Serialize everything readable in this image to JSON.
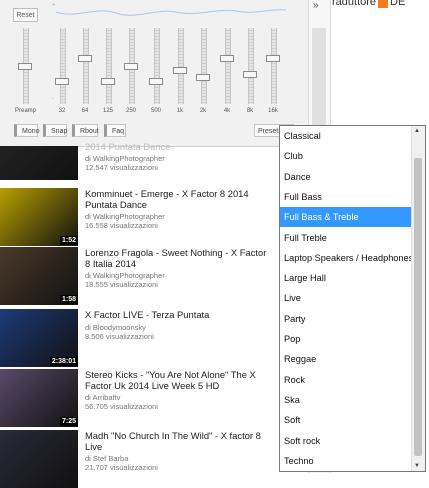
{
  "equalizer": {
    "reset_label": "Reset",
    "db_top": "+",
    "db_bottom": "-",
    "bands": [
      "Preamp",
      "32",
      "64",
      "125",
      "250",
      "500",
      "1k",
      "2k",
      "4k",
      "8k",
      "16k"
    ],
    "levels": [
      0.0,
      -0.4,
      0.2,
      -0.4,
      0.0,
      -0.4,
      -0.1,
      -0.3,
      0.2,
      -0.2,
      0.2
    ],
    "buttons": [
      "Mono",
      "Snap",
      "Rbout",
      "Faq"
    ],
    "presets_label": "Presets",
    "presets_arrow": "▼"
  },
  "sidebar": {
    "collapse_icon": "»"
  },
  "topright": {
    "text": "raduttore",
    "icon": "blogger-icon",
    "trail": "DE"
  },
  "videos": [
    {
      "title": "2014 Puntata Dance",
      "author": "di WalkingPhotographer",
      "views": "12.547 visualizzazioni",
      "duration": "",
      "thumb_color": "#222"
    },
    {
      "title": "Komminuet - Emerge - X Factor 8 2014 Puntata Dance",
      "author": "di WalkingPhotographer",
      "views": "16.558 visualizzazioni",
      "duration": "1:52",
      "thumb_color": "#b8a000"
    },
    {
      "title": "Lorenzo Fragola - Sweet Nothing - X Factor 8 Italia 2014",
      "author": "di WalkingPhotographer",
      "views": "18.555 visualizzazioni",
      "duration": "1:58",
      "thumb_color": "#4a3a2a"
    },
    {
      "title": "X Factor LIVE - Terza Puntata",
      "author": "di Bloodymoonsky",
      "views": "8.506 visualizzazioni",
      "duration": "2:38:01",
      "thumb_color": "#1d3a7a"
    },
    {
      "title": "Stereo Kicks - \"You Are Not Alone\" The X Factor Uk 2014 Live Week 5 HD",
      "author": "di Arribaftv",
      "views": "56.705 visualizzazioni",
      "duration": "7:25",
      "thumb_color": "#5a4a6a"
    },
    {
      "title": "Madh \"No Church In The Wild\" - X factor 8 Live",
      "author": "di Stef Barba",
      "views": "21.707 visualizzazioni",
      "duration": "",
      "thumb_color": "#2a2a3a"
    }
  ],
  "dropdown": {
    "options": [
      "Classical",
      "Club",
      "Dance",
      "Full Bass",
      "Full Bass & Treble",
      "Full Treble",
      "Laptop Speakers / Headphones",
      "Large Hall",
      "Live",
      "Party",
      "Pop",
      "Reggae",
      "Rock",
      "Ska",
      "Soft",
      "Soft rock",
      "Techno"
    ],
    "selected": "Full Bass & Treble",
    "up_arrow": "▲",
    "down_arrow": "▼"
  }
}
